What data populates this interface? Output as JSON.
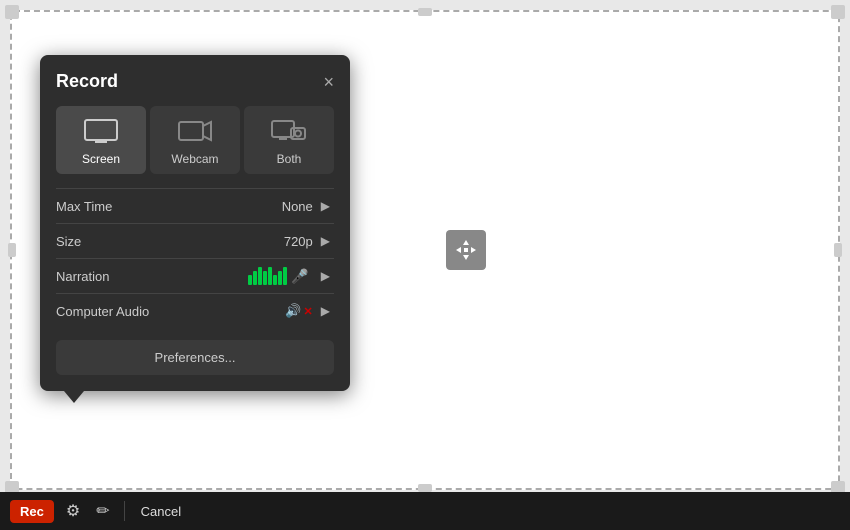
{
  "panel": {
    "title": "Record",
    "close_label": "×"
  },
  "modes": [
    {
      "id": "screen",
      "label": "Screen",
      "active": true
    },
    {
      "id": "webcam",
      "label": "Webcam",
      "active": false
    },
    {
      "id": "both",
      "label": "Both",
      "active": false
    }
  ],
  "settings": [
    {
      "id": "max-time",
      "label": "Max Time",
      "value": "None"
    },
    {
      "id": "size",
      "label": "Size",
      "value": "720p"
    },
    {
      "id": "narration",
      "label": "Narration",
      "value": ""
    },
    {
      "id": "computer-audio",
      "label": "Computer Audio",
      "value": ""
    }
  ],
  "preferences_label": "Preferences...",
  "toolbar": {
    "rec_label": "Rec",
    "cancel_label": "Cancel"
  }
}
